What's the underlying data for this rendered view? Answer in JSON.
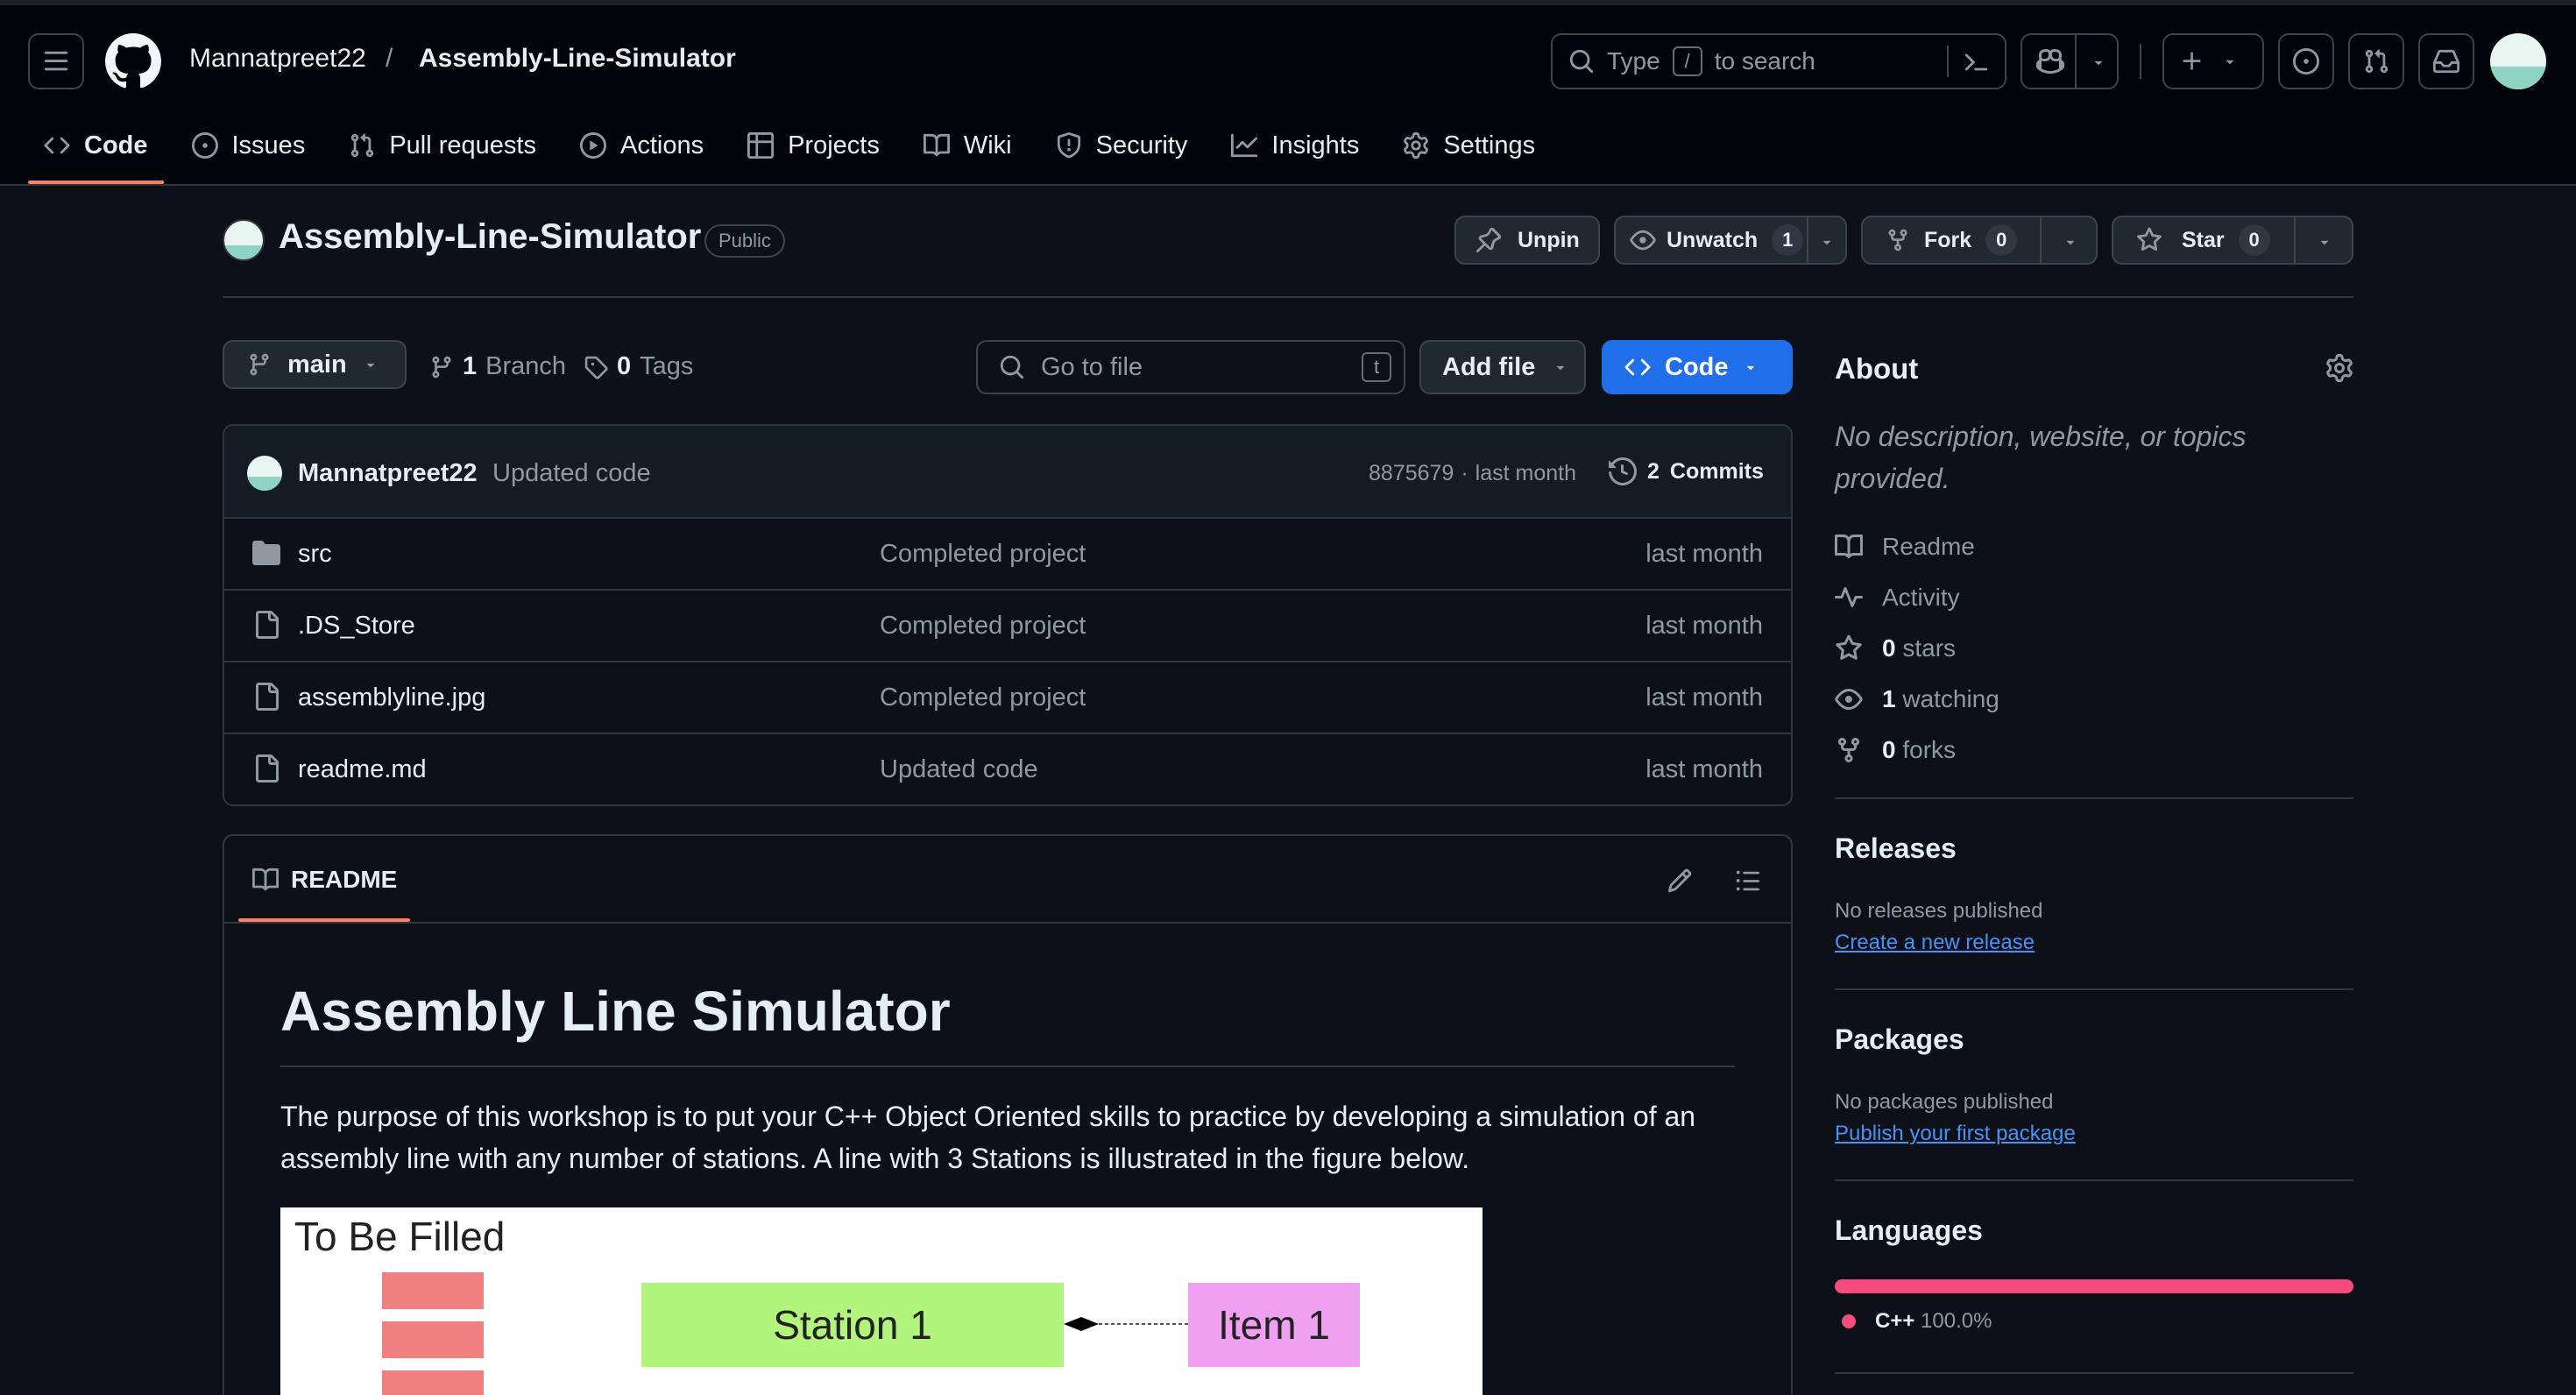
{
  "header": {
    "owner": "Mannatpreet22",
    "separator": "/",
    "repo": "Assembly-Line-Simulator",
    "search_pre": "Type",
    "search_key": "/",
    "search_post": "to search"
  },
  "nav": [
    {
      "label": "Code",
      "icon": "code-icon"
    },
    {
      "label": "Issues",
      "icon": "issue-icon"
    },
    {
      "label": "Pull requests",
      "icon": "pull-request-icon"
    },
    {
      "label": "Actions",
      "icon": "play-icon"
    },
    {
      "label": "Projects",
      "icon": "table-icon"
    },
    {
      "label": "Wiki",
      "icon": "book-icon"
    },
    {
      "label": "Security",
      "icon": "shield-icon"
    },
    {
      "label": "Insights",
      "icon": "graph-icon"
    },
    {
      "label": "Settings",
      "icon": "gear-icon"
    }
  ],
  "repo_header": {
    "name": "Assembly-Line-Simulator",
    "visibility": "Public",
    "unpin": "Unpin",
    "unwatch": "Unwatch",
    "watch_count": "1",
    "fork": "Fork",
    "fork_count": "0",
    "star": "Star",
    "star_count": "0"
  },
  "toolbar": {
    "branch": "main",
    "branch_count": "1",
    "branch_label": "Branch",
    "tag_count": "0",
    "tag_label": "Tags",
    "goto_placeholder": "Go to file",
    "goto_key": "t",
    "add_file": "Add file",
    "code": "Code"
  },
  "commit": {
    "author": "Mannatpreet22",
    "message": "Updated code",
    "hash": "8875679",
    "dot": "·",
    "time": "last month",
    "commits_count": "2",
    "commits_label": "Commits"
  },
  "files": [
    {
      "name": "src",
      "type": "folder",
      "message": "Completed project",
      "time": "last month"
    },
    {
      "name": ".DS_Store",
      "type": "file",
      "message": "Completed project",
      "time": "last month"
    },
    {
      "name": "assemblyline.jpg",
      "type": "file",
      "message": "Completed project",
      "time": "last month"
    },
    {
      "name": "readme.md",
      "type": "file",
      "message": "Updated code",
      "time": "last month"
    }
  ],
  "readme": {
    "tab": "README",
    "title": "Assembly Line Simulator",
    "body": "The purpose of this workshop is to put your C++ Object Oriented skills to practice by developing a simulation of an assembly line with any number of stations. A line with 3 Stations is illustrated in the figure below.",
    "figure": {
      "to_be_filled": "To Be Filled",
      "station": "Station 1",
      "item": "Item 1"
    }
  },
  "about": {
    "title": "About",
    "description": "No description, website, or topics provided.",
    "readme": "Readme",
    "activity": "Activity",
    "stars_count": "0",
    "stars_label": "stars",
    "watching_count": "1",
    "watching_label": "watching",
    "forks_count": "0",
    "forks_label": "forks"
  },
  "releases": {
    "title": "Releases",
    "none": "No releases published",
    "link": "Create a new release"
  },
  "packages": {
    "title": "Packages",
    "none": "No packages published",
    "link": "Publish your first package"
  },
  "languages": {
    "title": "Languages",
    "items": [
      {
        "name": "C++",
        "percent": "100.0%",
        "share": 1.0,
        "color": "#f34b7d"
      }
    ]
  },
  "colors": {
    "accent_blue": "#1f6feb",
    "nav_underline": "#f78166",
    "link": "#4493f8",
    "figure_red": "#f08080",
    "figure_green": "#b2f57d",
    "figure_pink": "#f0a0f0"
  }
}
